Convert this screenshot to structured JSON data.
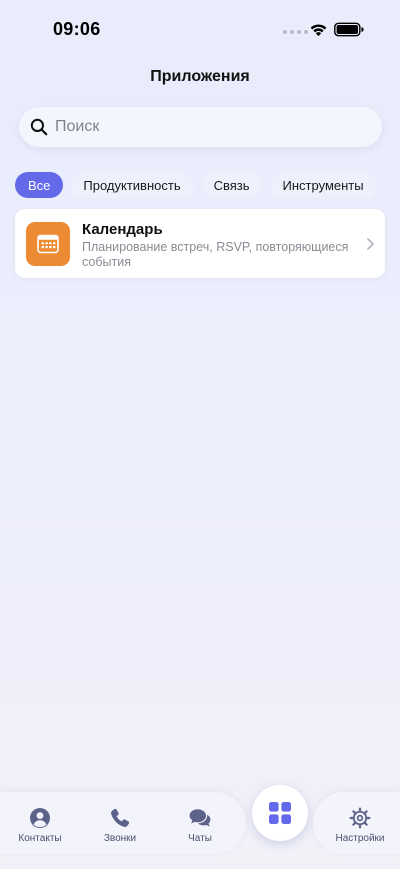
{
  "status_bar": {
    "time": "09:06",
    "icons": [
      "signal-dots-icon",
      "wifi-icon",
      "battery-icon"
    ]
  },
  "header": {
    "title": "Приложения"
  },
  "search": {
    "placeholder": "Поиск",
    "value": "",
    "icon": "search-icon"
  },
  "filters": [
    {
      "label": "Все",
      "active": true
    },
    {
      "label": "Продуктивность",
      "active": false
    },
    {
      "label": "Связь",
      "active": false
    },
    {
      "label": "Инструменты",
      "active": false
    }
  ],
  "apps": [
    {
      "name": "Календарь",
      "description": "Планирование встреч, RSVP, повторяющиеся события",
      "icon": "calendar-icon",
      "icon_color": "#ec8b33"
    }
  ],
  "tab_bar": {
    "items": [
      {
        "label": "Контакты",
        "icon": "person-icon"
      },
      {
        "label": "Звонки",
        "icon": "phone-icon"
      },
      {
        "label": "Чаты",
        "icon": "chat-bubbles-icon"
      },
      {
        "label": "",
        "icon": "apps-grid-icon",
        "active": true
      },
      {
        "label": "Настройки",
        "icon": "gear-icon"
      }
    ]
  },
  "colors": {
    "accent": "#6469e9",
    "tab_icon": "#5c628a",
    "app_icon_orange": "#ec8b33"
  }
}
